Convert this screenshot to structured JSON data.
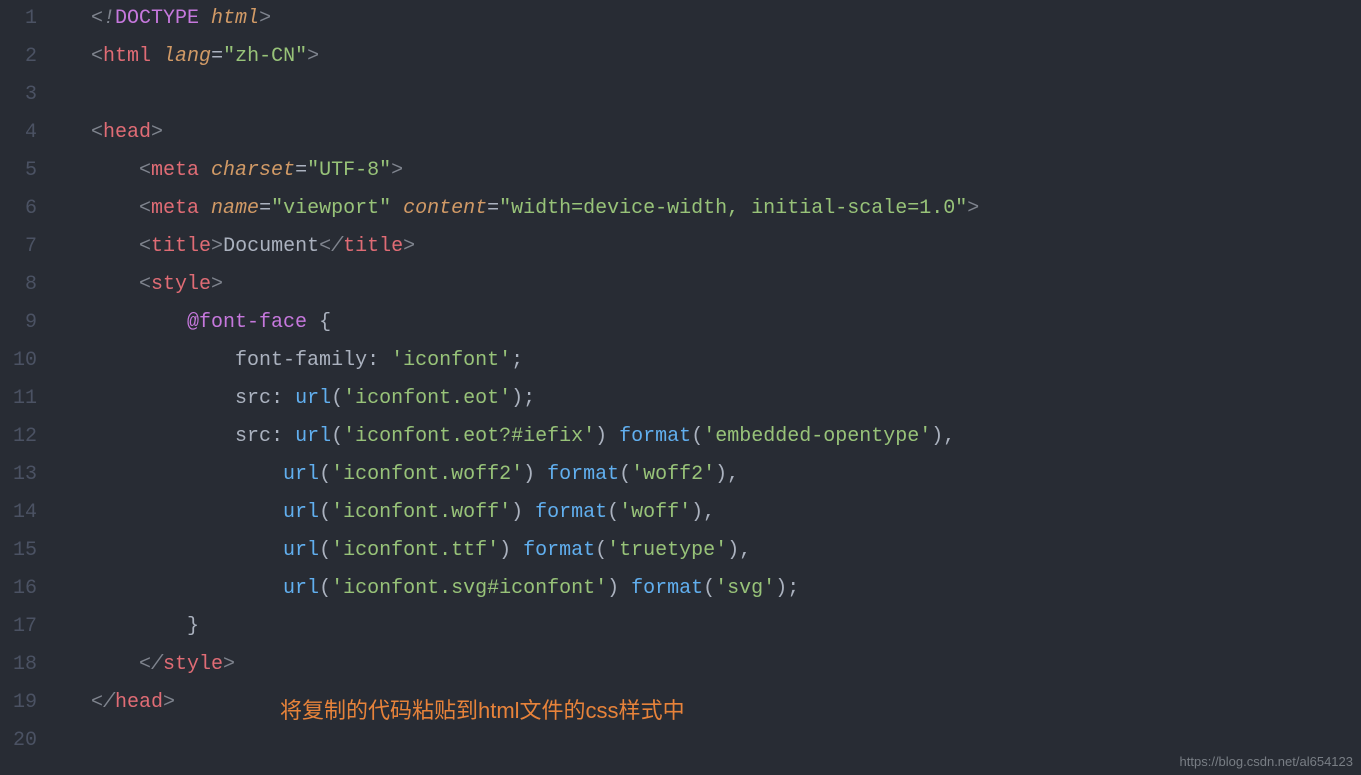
{
  "lineNumbers": [
    "1",
    "2",
    "3",
    "4",
    "5",
    "6",
    "7",
    "8",
    "9",
    "10",
    "11",
    "12",
    "13",
    "14",
    "15",
    "16",
    "17",
    "18",
    "19",
    "20"
  ],
  "code": {
    "l1": {
      "a": "<!",
      "b": "DOCTYPE",
      "c": " html",
      "d": ">"
    },
    "l2": {
      "a": "<",
      "b": "html",
      "c": " lang",
      "d": "=",
      "e": "\"zh-CN\"",
      "f": ">"
    },
    "l4": {
      "a": "<",
      "b": "head",
      "c": ">"
    },
    "l5": {
      "a": "    <",
      "b": "meta",
      "c": " charset",
      "d": "=",
      "e": "\"UTF-8\"",
      "f": ">"
    },
    "l6": {
      "a": "    <",
      "b": "meta",
      "c": " name",
      "d": "=",
      "e": "\"viewport\"",
      "f": " content",
      "g": "=",
      "h": "\"width=device-width, initial-scale=1.0\"",
      "i": ">"
    },
    "l7": {
      "a": "    <",
      "b": "title",
      "c": ">",
      "d": "Document",
      "e": "</",
      "f": "title",
      "g": ">"
    },
    "l8": {
      "a": "    <",
      "b": "style",
      "c": ">"
    },
    "l9": {
      "a": "        ",
      "b": "@font-face",
      "c": " {"
    },
    "l10": {
      "a": "            ",
      "b": "font-family",
      "c": ": ",
      "d": "'iconfont'",
      "e": ";"
    },
    "l11": {
      "a": "            ",
      "b": "src",
      "c": ": ",
      "d": "url",
      "e": "(",
      "f": "'iconfont.eot'",
      "g": ");"
    },
    "l12": {
      "a": "            ",
      "b": "src",
      "c": ": ",
      "d": "url",
      "e": "(",
      "f": "'iconfont.eot?#iefix'",
      "g": ") ",
      "h": "format",
      "i": "(",
      "j": "'embedded-opentype'",
      "k": "),"
    },
    "l13": {
      "a": "                ",
      "b": "url",
      "c": "(",
      "d": "'iconfont.woff2'",
      "e": ") ",
      "f": "format",
      "g": "(",
      "h": "'woff2'",
      "i": "),"
    },
    "l14": {
      "a": "                ",
      "b": "url",
      "c": "(",
      "d": "'iconfont.woff'",
      "e": ") ",
      "f": "format",
      "g": "(",
      "h": "'woff'",
      "i": "),"
    },
    "l15": {
      "a": "                ",
      "b": "url",
      "c": "(",
      "d": "'iconfont.ttf'",
      "e": ") ",
      "f": "format",
      "g": "(",
      "h": "'truetype'",
      "i": "),"
    },
    "l16": {
      "a": "                ",
      "b": "url",
      "c": "(",
      "d": "'iconfont.svg#iconfont'",
      "e": ") ",
      "f": "format",
      "g": "(",
      "h": "'svg'",
      "i": ");"
    },
    "l17": {
      "a": "        }"
    },
    "l18": {
      "a": "    </",
      "b": "style",
      "c": ">"
    },
    "l19": {
      "a": "</",
      "b": "head",
      "c": ">"
    }
  },
  "annotation": "将复制的代码粘贴到html文件的css样式中",
  "watermark": "https://blog.csdn.net/al654123"
}
